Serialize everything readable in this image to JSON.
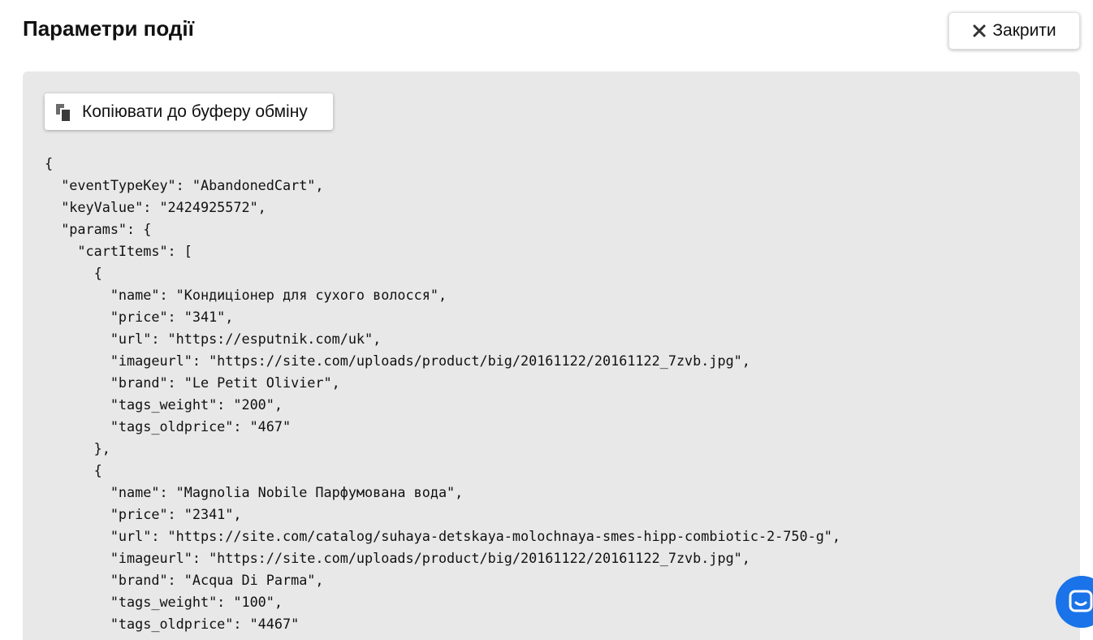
{
  "header": {
    "title": "Параметри події",
    "close_label": "Закрити"
  },
  "panel": {
    "copy_label": "Копіювати до буферу обміну",
    "code": "{\n  \"eventTypeKey\": \"AbandonedCart\",\n  \"keyValue\": \"2424925572\",\n  \"params\": {\n    \"cartItems\": [\n      {\n        \"name\": \"Кондиціонер для сухого волосся\",\n        \"price\": \"341\",\n        \"url\": \"https://esputnik.com/uk\",\n        \"imageurl\": \"https://site.com/uploads/product/big/20161122/20161122_7zvb.jpg\",\n        \"brand\": \"Le Petit Olivier\",\n        \"tags_weight\": \"200\",\n        \"tags_oldprice\": \"467\"\n      },\n      {\n        \"name\": \"Magnolia Nobile Парфумована вода\",\n        \"price\": \"2341\",\n        \"url\": \"https://site.com/catalog/suhaya-detskaya-molochnaya-smes-hipp-combiotic-2-750-g\",\n        \"imageurl\": \"https://site.com/uploads/product/big/20161122/20161122_7zvb.jpg\",\n        \"brand\": \"Acqua Di Parma\",\n        \"tags_weight\": \"100\",\n        \"tags_oldprice\": \"4467\""
  },
  "icons": {
    "close": "close-icon",
    "copy": "copy-icon",
    "chat": "chat-icon"
  },
  "colors": {
    "panel_background": "#e8e8e8",
    "chat_button": "#1a73e8"
  }
}
